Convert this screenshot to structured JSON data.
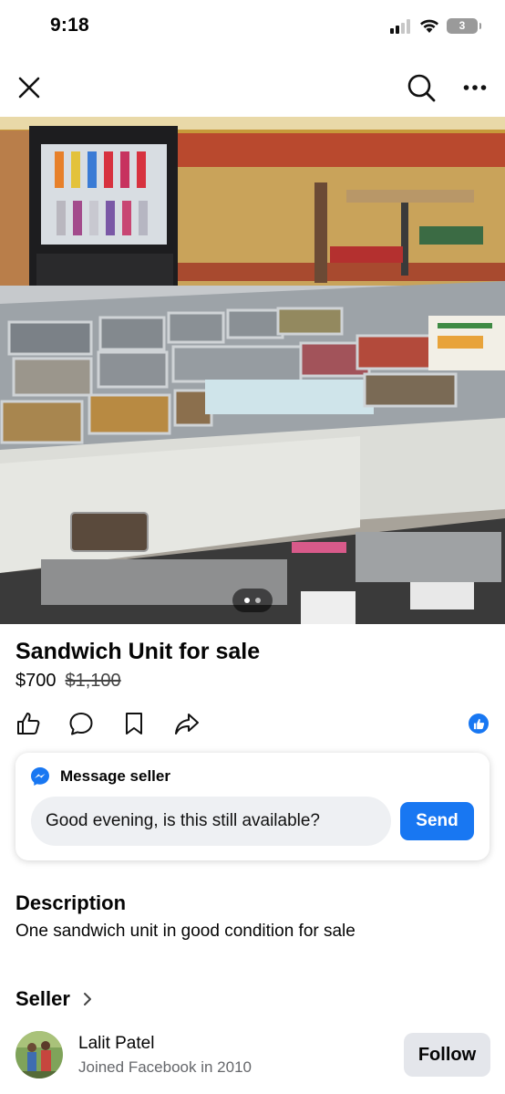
{
  "status_bar": {
    "time": "9:18",
    "battery_level": "3"
  },
  "listing": {
    "title": "Sandwich Unit for sale",
    "price": "$700",
    "original_price": "$1,100",
    "photo_pager": {
      "current": 1,
      "total": 2
    }
  },
  "message_card": {
    "header": "Message seller",
    "message_text": "Good evening, is this still available?",
    "send_label": "Send"
  },
  "description": {
    "heading": "Description",
    "text": "One sandwich unit in good condition for sale"
  },
  "seller": {
    "heading": "Seller",
    "name": "Lalit Patel",
    "joined": "Joined Facebook in 2010",
    "follow_label": "Follow"
  },
  "icons": {
    "close": "close-icon",
    "search": "search-icon",
    "more": "more-horizontal-icon",
    "like": "like-icon",
    "comment": "comment-icon",
    "save": "bookmark-icon",
    "share": "share-icon",
    "messenger": "messenger-icon",
    "chevron": "chevron-right-icon"
  },
  "colors": {
    "accent": "#1877f2",
    "button_gray": "#e4e6eb",
    "input_gray": "#eef0f3",
    "secondary_text": "#65676b"
  }
}
